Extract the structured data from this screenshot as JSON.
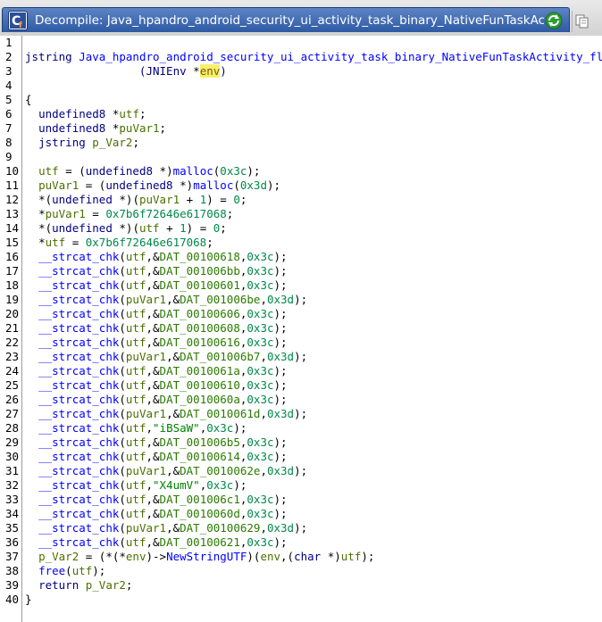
{
  "window": {
    "tab_title": "Decompile: Java_hpandro_android_security_ui_activity_task_binary_NativeFunTaskActivity_fl...",
    "icons": {
      "tab": "decompile-icon",
      "refresh": "refresh-icon",
      "copy": "copy-icon"
    }
  },
  "editor": {
    "line_numbers": [
      "1",
      "2",
      "3",
      "4",
      "5",
      "6",
      "7",
      "8",
      "9",
      "10",
      "11",
      "12",
      "13",
      "14",
      "15",
      "16",
      "17",
      "18",
      "19",
      "20",
      "21",
      "22",
      "23",
      "24",
      "25",
      "26",
      "27",
      "28",
      "29",
      "30",
      "31",
      "32",
      "33",
      "34",
      "35",
      "36",
      "37",
      "38",
      "39",
      "40"
    ],
    "lines": [
      [],
      [
        [
          "type",
          "jstring "
        ],
        [
          "fn",
          "Java_hpandro_android_security_ui_activity_task_binary_NativeFunTaskActivity_flag"
        ]
      ],
      [
        [
          "plain",
          "                 ("
        ],
        [
          "type",
          "JNIEnv "
        ],
        [
          "op",
          "*"
        ],
        [
          "hl",
          "env"
        ],
        [
          "plain",
          ")"
        ]
      ],
      [],
      [
        [
          "op",
          "{"
        ]
      ],
      [
        [
          "plain",
          "  "
        ],
        [
          "type",
          "undefined8 "
        ],
        [
          "op",
          "*"
        ],
        [
          "var",
          "utf"
        ],
        [
          "op",
          ";"
        ]
      ],
      [
        [
          "plain",
          "  "
        ],
        [
          "type",
          "undefined8 "
        ],
        [
          "op",
          "*"
        ],
        [
          "var",
          "puVar1"
        ],
        [
          "op",
          ";"
        ]
      ],
      [
        [
          "plain",
          "  "
        ],
        [
          "type",
          "jstring "
        ],
        [
          "var",
          "p_Var2"
        ],
        [
          "op",
          ";"
        ]
      ],
      [],
      [
        [
          "plain",
          "  "
        ],
        [
          "var",
          "utf"
        ],
        [
          "op",
          " = ("
        ],
        [
          "type",
          "undefined8 "
        ],
        [
          "op",
          "*)"
        ],
        [
          "fn",
          "malloc"
        ],
        [
          "op",
          "("
        ],
        [
          "num",
          "0x3c"
        ],
        [
          "op",
          ");"
        ]
      ],
      [
        [
          "plain",
          "  "
        ],
        [
          "var",
          "puVar1"
        ],
        [
          "op",
          " = ("
        ],
        [
          "type",
          "undefined8 "
        ],
        [
          "op",
          "*)"
        ],
        [
          "fn",
          "malloc"
        ],
        [
          "op",
          "("
        ],
        [
          "num",
          "0x3d"
        ],
        [
          "op",
          ");"
        ]
      ],
      [
        [
          "plain",
          "  "
        ],
        [
          "op",
          "*("
        ],
        [
          "type",
          "undefined "
        ],
        [
          "op",
          "*)("
        ],
        [
          "var",
          "puVar1"
        ],
        [
          "op",
          " + "
        ],
        [
          "num",
          "1"
        ],
        [
          "op",
          ") = "
        ],
        [
          "num",
          "0"
        ],
        [
          "op",
          ";"
        ]
      ],
      [
        [
          "plain",
          "  "
        ],
        [
          "op",
          "*"
        ],
        [
          "var",
          "puVar1"
        ],
        [
          "op",
          " = "
        ],
        [
          "num",
          "0x7b6f72646e617068"
        ],
        [
          "op",
          ";"
        ]
      ],
      [
        [
          "plain",
          "  "
        ],
        [
          "op",
          "*("
        ],
        [
          "type",
          "undefined "
        ],
        [
          "op",
          "*)("
        ],
        [
          "var",
          "utf"
        ],
        [
          "op",
          " + "
        ],
        [
          "num",
          "1"
        ],
        [
          "op",
          ") = "
        ],
        [
          "num",
          "0"
        ],
        [
          "op",
          ";"
        ]
      ],
      [
        [
          "plain",
          "  "
        ],
        [
          "op",
          "*"
        ],
        [
          "var",
          "utf"
        ],
        [
          "op",
          " = "
        ],
        [
          "num",
          "0x7b6f72646e617068"
        ],
        [
          "op",
          ";"
        ]
      ],
      [
        [
          "plain",
          "  "
        ],
        [
          "fn",
          "__strcat_chk"
        ],
        [
          "op",
          "("
        ],
        [
          "var",
          "utf"
        ],
        [
          "op",
          ",&"
        ],
        [
          "var2",
          "DAT_00100618"
        ],
        [
          "op",
          ","
        ],
        [
          "num",
          "0x3c"
        ],
        [
          "op",
          ");"
        ]
      ],
      [
        [
          "plain",
          "  "
        ],
        [
          "fn",
          "__strcat_chk"
        ],
        [
          "op",
          "("
        ],
        [
          "var",
          "utf"
        ],
        [
          "op",
          ",&"
        ],
        [
          "var2",
          "DAT_001006bb"
        ],
        [
          "op",
          ","
        ],
        [
          "num",
          "0x3c"
        ],
        [
          "op",
          ");"
        ]
      ],
      [
        [
          "plain",
          "  "
        ],
        [
          "fn",
          "__strcat_chk"
        ],
        [
          "op",
          "("
        ],
        [
          "var",
          "utf"
        ],
        [
          "op",
          ",&"
        ],
        [
          "var2",
          "DAT_00100601"
        ],
        [
          "op",
          ","
        ],
        [
          "num",
          "0x3c"
        ],
        [
          "op",
          ");"
        ]
      ],
      [
        [
          "plain",
          "  "
        ],
        [
          "fn",
          "__strcat_chk"
        ],
        [
          "op",
          "("
        ],
        [
          "var",
          "puVar1"
        ],
        [
          "op",
          ",&"
        ],
        [
          "var2",
          "DAT_001006be"
        ],
        [
          "op",
          ","
        ],
        [
          "num",
          "0x3d"
        ],
        [
          "op",
          ");"
        ]
      ],
      [
        [
          "plain",
          "  "
        ],
        [
          "fn",
          "__strcat_chk"
        ],
        [
          "op",
          "("
        ],
        [
          "var",
          "utf"
        ],
        [
          "op",
          ",&"
        ],
        [
          "var2",
          "DAT_00100606"
        ],
        [
          "op",
          ","
        ],
        [
          "num",
          "0x3c"
        ],
        [
          "op",
          ");"
        ]
      ],
      [
        [
          "plain",
          "  "
        ],
        [
          "fn",
          "__strcat_chk"
        ],
        [
          "op",
          "("
        ],
        [
          "var",
          "utf"
        ],
        [
          "op",
          ",&"
        ],
        [
          "var2",
          "DAT_00100608"
        ],
        [
          "op",
          ","
        ],
        [
          "num",
          "0x3c"
        ],
        [
          "op",
          ");"
        ]
      ],
      [
        [
          "plain",
          "  "
        ],
        [
          "fn",
          "__strcat_chk"
        ],
        [
          "op",
          "("
        ],
        [
          "var",
          "utf"
        ],
        [
          "op",
          ",&"
        ],
        [
          "var2",
          "DAT_00100616"
        ],
        [
          "op",
          ","
        ],
        [
          "num",
          "0x3c"
        ],
        [
          "op",
          ");"
        ]
      ],
      [
        [
          "plain",
          "  "
        ],
        [
          "fn",
          "__strcat_chk"
        ],
        [
          "op",
          "("
        ],
        [
          "var",
          "puVar1"
        ],
        [
          "op",
          ",&"
        ],
        [
          "var2",
          "DAT_001006b7"
        ],
        [
          "op",
          ","
        ],
        [
          "num",
          "0x3d"
        ],
        [
          "op",
          ");"
        ]
      ],
      [
        [
          "plain",
          "  "
        ],
        [
          "fn",
          "__strcat_chk"
        ],
        [
          "op",
          "("
        ],
        [
          "var",
          "utf"
        ],
        [
          "op",
          ",&"
        ],
        [
          "var2",
          "DAT_0010061a"
        ],
        [
          "op",
          ","
        ],
        [
          "num",
          "0x3c"
        ],
        [
          "op",
          ");"
        ]
      ],
      [
        [
          "plain",
          "  "
        ],
        [
          "fn",
          "__strcat_chk"
        ],
        [
          "op",
          "("
        ],
        [
          "var",
          "utf"
        ],
        [
          "op",
          ",&"
        ],
        [
          "var2",
          "DAT_00100610"
        ],
        [
          "op",
          ","
        ],
        [
          "num",
          "0x3c"
        ],
        [
          "op",
          ");"
        ]
      ],
      [
        [
          "plain",
          "  "
        ],
        [
          "fn",
          "__strcat_chk"
        ],
        [
          "op",
          "("
        ],
        [
          "var",
          "utf"
        ],
        [
          "op",
          ",&"
        ],
        [
          "var2",
          "DAT_0010060a"
        ],
        [
          "op",
          ","
        ],
        [
          "num",
          "0x3c"
        ],
        [
          "op",
          ");"
        ]
      ],
      [
        [
          "plain",
          "  "
        ],
        [
          "fn",
          "__strcat_chk"
        ],
        [
          "op",
          "("
        ],
        [
          "var",
          "puVar1"
        ],
        [
          "op",
          ",&"
        ],
        [
          "var2",
          "DAT_0010061d"
        ],
        [
          "op",
          ","
        ],
        [
          "num",
          "0x3d"
        ],
        [
          "op",
          ");"
        ]
      ],
      [
        [
          "plain",
          "  "
        ],
        [
          "fn",
          "__strcat_chk"
        ],
        [
          "op",
          "("
        ],
        [
          "var",
          "utf"
        ],
        [
          "op",
          ","
        ],
        [
          "str",
          "\"iBSaW\""
        ],
        [
          "op",
          ","
        ],
        [
          "num",
          "0x3c"
        ],
        [
          "op",
          ");"
        ]
      ],
      [
        [
          "plain",
          "  "
        ],
        [
          "fn",
          "__strcat_chk"
        ],
        [
          "op",
          "("
        ],
        [
          "var",
          "utf"
        ],
        [
          "op",
          ",&"
        ],
        [
          "var2",
          "DAT_001006b5"
        ],
        [
          "op",
          ","
        ],
        [
          "num",
          "0x3c"
        ],
        [
          "op",
          ");"
        ]
      ],
      [
        [
          "plain",
          "  "
        ],
        [
          "fn",
          "__strcat_chk"
        ],
        [
          "op",
          "("
        ],
        [
          "var",
          "utf"
        ],
        [
          "op",
          ",&"
        ],
        [
          "var2",
          "DAT_00100614"
        ],
        [
          "op",
          ","
        ],
        [
          "num",
          "0x3c"
        ],
        [
          "op",
          ");"
        ]
      ],
      [
        [
          "plain",
          "  "
        ],
        [
          "fn",
          "__strcat_chk"
        ],
        [
          "op",
          "("
        ],
        [
          "var",
          "puVar1"
        ],
        [
          "op",
          ",&"
        ],
        [
          "var2",
          "DAT_0010062e"
        ],
        [
          "op",
          ","
        ],
        [
          "num",
          "0x3d"
        ],
        [
          "op",
          ");"
        ]
      ],
      [
        [
          "plain",
          "  "
        ],
        [
          "fn",
          "__strcat_chk"
        ],
        [
          "op",
          "("
        ],
        [
          "var",
          "utf"
        ],
        [
          "op",
          ","
        ],
        [
          "str",
          "\"X4umV\""
        ],
        [
          "op",
          ","
        ],
        [
          "num",
          "0x3c"
        ],
        [
          "op",
          ");"
        ]
      ],
      [
        [
          "plain",
          "  "
        ],
        [
          "fn",
          "__strcat_chk"
        ],
        [
          "op",
          "("
        ],
        [
          "var",
          "utf"
        ],
        [
          "op",
          ",&"
        ],
        [
          "var2",
          "DAT_001006c1"
        ],
        [
          "op",
          ","
        ],
        [
          "num",
          "0x3c"
        ],
        [
          "op",
          ");"
        ]
      ],
      [
        [
          "plain",
          "  "
        ],
        [
          "fn",
          "__strcat_chk"
        ],
        [
          "op",
          "("
        ],
        [
          "var",
          "utf"
        ],
        [
          "op",
          ",&"
        ],
        [
          "var2",
          "DAT_0010060d"
        ],
        [
          "op",
          ","
        ],
        [
          "num",
          "0x3c"
        ],
        [
          "op",
          ");"
        ]
      ],
      [
        [
          "plain",
          "  "
        ],
        [
          "fn",
          "__strcat_chk"
        ],
        [
          "op",
          "("
        ],
        [
          "var",
          "puVar1"
        ],
        [
          "op",
          ",&"
        ],
        [
          "var2",
          "DAT_00100629"
        ],
        [
          "op",
          ","
        ],
        [
          "num",
          "0x3d"
        ],
        [
          "op",
          ");"
        ]
      ],
      [
        [
          "plain",
          "  "
        ],
        [
          "fn",
          "__strcat_chk"
        ],
        [
          "op",
          "("
        ],
        [
          "var",
          "utf"
        ],
        [
          "op",
          ",&"
        ],
        [
          "var2",
          "DAT_00100621"
        ],
        [
          "op",
          ","
        ],
        [
          "num",
          "0x3c"
        ],
        [
          "op",
          ");"
        ]
      ],
      [
        [
          "plain",
          "  "
        ],
        [
          "var",
          "p_Var2"
        ],
        [
          "op",
          " = (*(*"
        ],
        [
          "var",
          "env"
        ],
        [
          "op",
          ")->"
        ],
        [
          "fn",
          "NewStringUTF"
        ],
        [
          "op",
          ")("
        ],
        [
          "var",
          "env"
        ],
        [
          "op",
          ",("
        ],
        [
          "kw",
          "char "
        ],
        [
          "op",
          "*)"
        ],
        [
          "var",
          "utf"
        ],
        [
          "op",
          ");"
        ]
      ],
      [
        [
          "plain",
          "  "
        ],
        [
          "fn",
          "free"
        ],
        [
          "op",
          "("
        ],
        [
          "var",
          "utf"
        ],
        [
          "op",
          ");"
        ]
      ],
      [
        [
          "plain",
          "  "
        ],
        [
          "kw",
          "return "
        ],
        [
          "var",
          "p_Var2"
        ],
        [
          "op",
          ";"
        ]
      ],
      [
        [
          "op",
          "}"
        ]
      ]
    ]
  }
}
